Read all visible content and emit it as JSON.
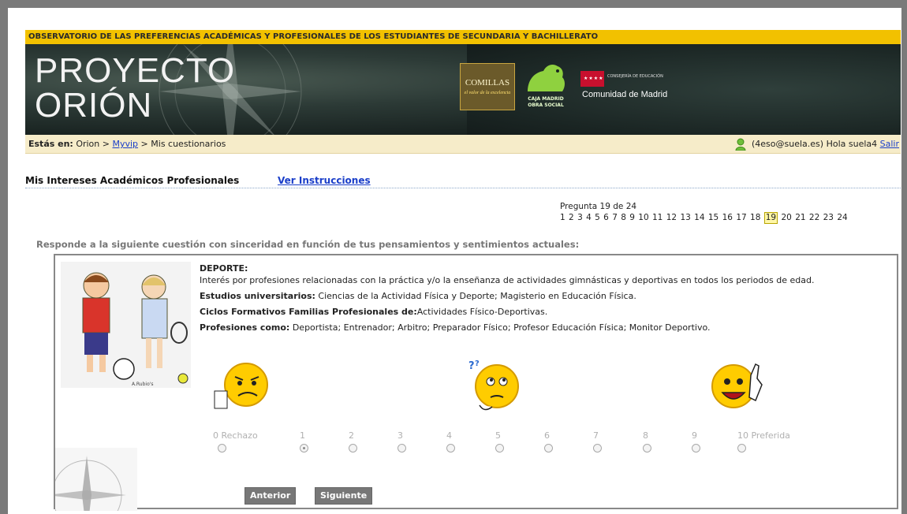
{
  "header": {
    "top_band": "OBSERVATORIO DE LAS PREFERENCIAS ACADÉMICAS Y PROFESIONALES DE LOS ESTUDIANTES DE SECUNDARIA Y BACHILLERATO",
    "brand_line1": "PROYECTO",
    "brand_line2": "ORIÓN",
    "logo_comillas": "COMILLAS",
    "logo_comillas_sub": "el valor de la excelencia",
    "logo_caja": "CAJA MADRID",
    "logo_caja_sub": "OBRA SOCIAL",
    "logo_cm_small": "CONSEJERÍA DE EDUCACIÓN",
    "logo_cm_big": "Comunidad de Madrid"
  },
  "breadcrumb": {
    "prefix": "Estás en:",
    "root": "Orion",
    "sep": ">",
    "link": "Myvip",
    "current": "Mis cuestionarios",
    "user_text": "(4eso@suela.es) Hola suela4",
    "logout": "Salir"
  },
  "section": {
    "title": "Mis Intereses Académicos Profesionales",
    "instructions_link": "Ver Instrucciones"
  },
  "pager": {
    "label": "Pregunta 19 de 24",
    "pages": [
      "1",
      "2",
      "3",
      "4",
      "5",
      "6",
      "7",
      "8",
      "9",
      "10",
      "11",
      "12",
      "13",
      "14",
      "15",
      "16",
      "17",
      "18",
      "19",
      "20",
      "21",
      "22",
      "23",
      "24"
    ],
    "current": "19"
  },
  "instruction": "Responde a la siguiente cuestión con sinceridad en función de tus pensamientos y sentimientos actuales:",
  "question": {
    "title": "DEPORTE:",
    "description": "Interés por profesiones relacionadas con la práctica y/o la enseñanza de actividades gimnásticas y deportivas en todos los periodos de edad.",
    "studies_label": "Estudios universitarios:",
    "studies": " Ciencias de la Actividad Física y Deporte; Magisterio en Educación Física.",
    "cycles_label": "Ciclos Formativos Familias Profesionales de:",
    "cycles": "Actividades Físico-Deportivas.",
    "professions_label": "Profesiones como:",
    "professions": " Deportista; Entrenador; Arbitro; Preparador Físico; Profesor Educación Física; Monitor Deportivo.",
    "image_caption": "A.Rubio's"
  },
  "scale": {
    "options": [
      "0 Rechazo",
      "1",
      "2",
      "3",
      "4",
      "5",
      "6",
      "7",
      "8",
      "9",
      "10 Preferida"
    ],
    "selected": "1"
  },
  "buttons": {
    "prev": "Anterior",
    "next": "Siguiente"
  },
  "colors": {
    "top_band": "#f2c100",
    "crumb_bg": "#f6ecc9",
    "link": "#1a3ec9",
    "button": "#777777"
  }
}
